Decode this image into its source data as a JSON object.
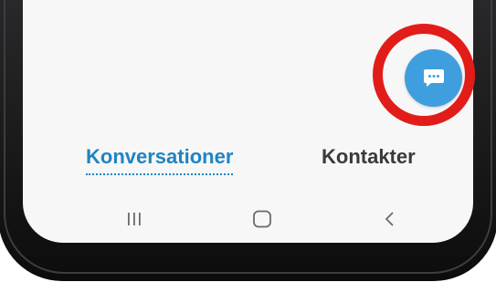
{
  "fab": {
    "icon": "chat-bubble-icon"
  },
  "highlight": {
    "color": "#e21d19"
  },
  "tabs": [
    {
      "label": "Konversationer",
      "active": true
    },
    {
      "label": "Kontakter",
      "active": false
    }
  ],
  "nav": {
    "recents_icon": "recent-apps-icon",
    "home_icon": "home-icon",
    "back_icon": "back-icon"
  },
  "colors": {
    "accent": "#1f84c2",
    "fab": "#3f9edd"
  }
}
